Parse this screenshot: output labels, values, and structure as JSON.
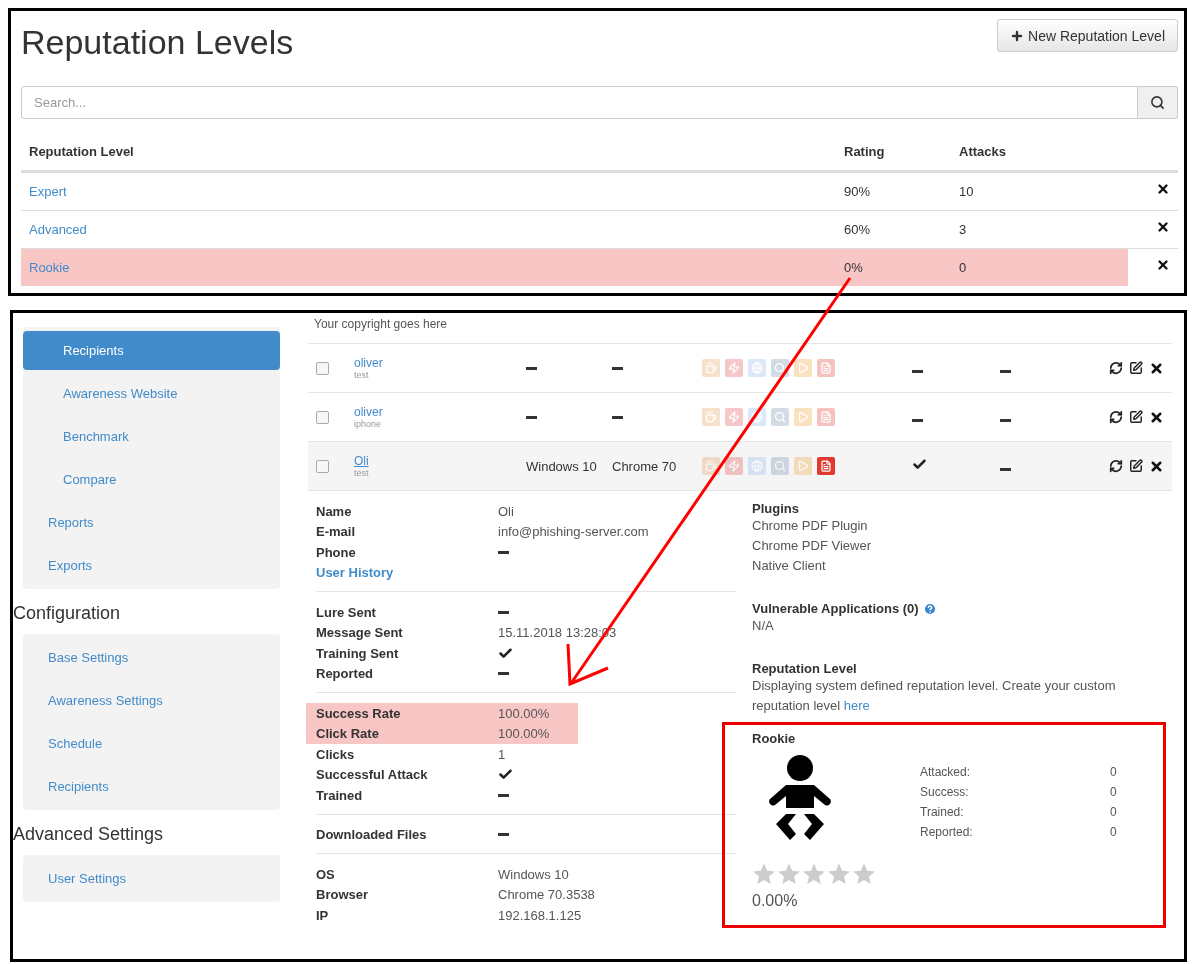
{
  "reputation_levels": {
    "title": "Reputation Levels",
    "new_button": "New Reputation Level",
    "search": {
      "placeholder": "Search..."
    },
    "columns": [
      "Reputation Level",
      "Rating",
      "Attacks"
    ],
    "rows": [
      {
        "name": "Expert",
        "rating": "90%",
        "attacks": "10",
        "selected": false
      },
      {
        "name": "Advanced",
        "rating": "60%",
        "attacks": "3",
        "selected": false
      },
      {
        "name": "Rookie",
        "rating": "0%",
        "attacks": "0",
        "selected": true
      }
    ]
  },
  "recipient_view": {
    "copyright": "Your copyright goes here",
    "sidebar": {
      "groups": [
        {
          "items": [
            {
              "label": "Recipients",
              "kind": "sub",
              "selected": true
            },
            {
              "label": "Awareness Website",
              "kind": "sub",
              "selected": false
            },
            {
              "label": "Benchmark",
              "kind": "sub",
              "selected": false
            },
            {
              "label": "Compare",
              "kind": "sub",
              "selected": false
            },
            {
              "label": "Reports",
              "kind": "item",
              "selected": false
            },
            {
              "label": "Exports",
              "kind": "item",
              "selected": false
            }
          ]
        },
        {
          "heading": "Configuration",
          "items": [
            {
              "label": "Base Settings",
              "kind": "item",
              "selected": false
            },
            {
              "label": "Awareness Settings",
              "kind": "item",
              "selected": false
            },
            {
              "label": "Schedule",
              "kind": "item",
              "selected": false
            },
            {
              "label": "Recipients",
              "kind": "item",
              "selected": false
            }
          ]
        },
        {
          "heading": "Advanced Settings",
          "items": [
            {
              "label": "User Settings",
              "kind": "item",
              "selected": false
            }
          ]
        }
      ]
    },
    "recipients": [
      {
        "name": "oliver",
        "device": "test",
        "checked": false,
        "selected": false,
        "plugins": [
          {
            "active": false
          },
          {
            "active": false
          },
          {
            "active": false
          },
          {
            "active": false
          },
          {
            "active": false
          },
          {
            "active": false
          }
        ],
        "clicked": false,
        "reported": false
      },
      {
        "name": "oliver",
        "device": "iphone",
        "checked": false,
        "selected": false,
        "plugins": [
          {
            "active": false
          },
          {
            "active": false
          },
          {
            "active": false
          },
          {
            "active": false
          },
          {
            "active": false
          },
          {
            "active": false
          }
        ],
        "clicked": false,
        "reported": false
      },
      {
        "name": "Oli",
        "device": "test",
        "os": "Windows 10",
        "browser": "Chrome 70",
        "checked": false,
        "selected": true,
        "plugins": [
          {
            "active": false
          },
          {
            "active": false
          },
          {
            "active": false
          },
          {
            "active": false
          },
          {
            "active": false
          },
          {
            "active": true
          }
        ],
        "clicked": true,
        "reported": false
      }
    ],
    "details": [
      {
        "rows": [
          {
            "label": "Name",
            "kind": "text",
            "value": "Oli",
            "highlighted": false
          },
          {
            "label": "E-mail",
            "kind": "text",
            "value": "info@phishing-server.com",
            "highlighted": false
          },
          {
            "label": "Phone",
            "kind": "minus",
            "highlighted": false
          },
          {
            "label": "User History",
            "kind": "link",
            "highlighted": false
          }
        ]
      },
      {
        "rows": [
          {
            "label": "Lure Sent",
            "kind": "minus",
            "highlighted": false
          },
          {
            "label": "Message Sent",
            "kind": "text",
            "value": "15.11.2018 13:28:03",
            "highlighted": false
          },
          {
            "label": "Training Sent",
            "kind": "check",
            "highlighted": false
          },
          {
            "label": "Reported",
            "kind": "minus",
            "highlighted": false
          }
        ]
      },
      {
        "rows": [
          {
            "label": "Success Rate",
            "kind": "text",
            "value": "100.00%",
            "highlighted": true
          },
          {
            "label": "Click Rate",
            "kind": "text",
            "value": "100.00%",
            "highlighted": true
          },
          {
            "label": "Clicks",
            "kind": "text",
            "value": "1",
            "highlighted": false
          },
          {
            "label": "Successful Attack",
            "kind": "check",
            "highlighted": false
          },
          {
            "label": "Trained",
            "kind": "minus",
            "highlighted": false
          }
        ]
      },
      {
        "rows": [
          {
            "label": "Downloaded Files",
            "kind": "minus",
            "highlighted": false
          }
        ]
      },
      {
        "rows": [
          {
            "label": "OS",
            "kind": "text",
            "value": "Windows 10",
            "highlighted": false
          },
          {
            "label": "Browser",
            "kind": "text",
            "value": "Chrome 70.3538",
            "highlighted": false
          },
          {
            "label": "IP",
            "kind": "text",
            "value": "192.168.1.125",
            "highlighted": false
          }
        ]
      }
    ],
    "plugins": {
      "heading": "Plugins",
      "items": [
        "Chrome PDF Plugin",
        "Chrome PDF Viewer",
        "Native Client"
      ]
    },
    "vulnerable": {
      "heading": "Vulnerable Applications (0)",
      "value": "N/A"
    },
    "reputation": {
      "heading": "Reputation Level",
      "text": "Displaying system defined reputation level. Create your custom reputation level",
      "link": "here"
    },
    "level_card": {
      "title": "Rookie",
      "stats": [
        {
          "label": "Attacked:",
          "value": "0"
        },
        {
          "label": "Success:",
          "value": "0"
        },
        {
          "label": "Trained:",
          "value": "0"
        },
        {
          "label": "Reported:",
          "value": "0"
        }
      ],
      "stars": 0,
      "percent": "0.00%"
    }
  }
}
